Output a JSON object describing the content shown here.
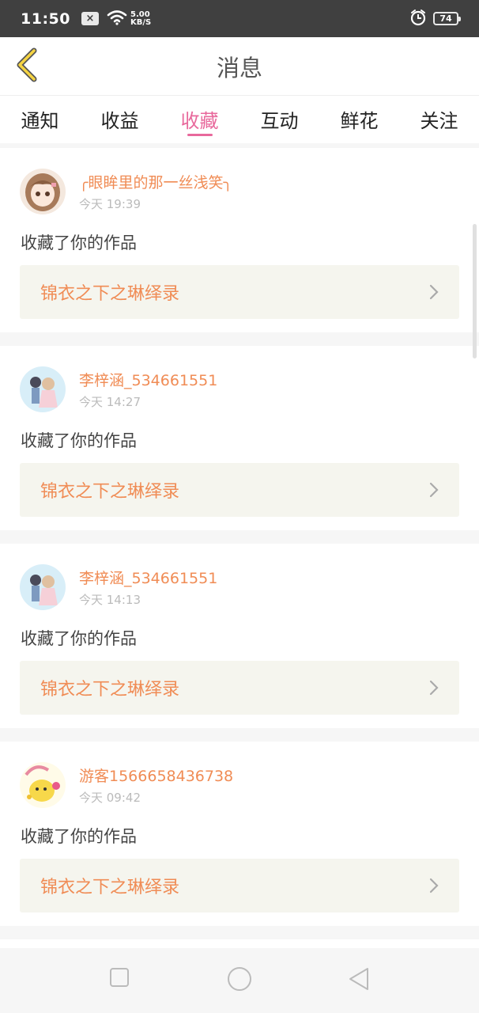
{
  "status_bar": {
    "time": "11:50",
    "notif_icon": "×",
    "speed_value": "5.00",
    "speed_unit": "KB/S",
    "battery": "74"
  },
  "header": {
    "title": "消息"
  },
  "tabs": [
    {
      "label": "通知",
      "active": false
    },
    {
      "label": "收益",
      "active": false
    },
    {
      "label": "收藏",
      "active": true
    },
    {
      "label": "互动",
      "active": false
    },
    {
      "label": "鲜花",
      "active": false
    },
    {
      "label": "关注",
      "active": false
    }
  ],
  "cards": [
    {
      "username": "╭眼眸里的那一丝浅笑╮",
      "time": "今天 19:39",
      "action": "收藏了你的作品",
      "work": "锦衣之下之琳绎录",
      "avatar": "avatar-girl-brown-hair"
    },
    {
      "username": "李梓涵_534661551",
      "time": "今天 14:27",
      "action": "收藏了你的作品",
      "work": "锦衣之下之琳绎录",
      "avatar": "avatar-couple"
    },
    {
      "username": "李梓涵_534661551",
      "time": "今天 14:13",
      "action": "收藏了你的作品",
      "work": "锦衣之下之琳绎录",
      "avatar": "avatar-couple"
    },
    {
      "username": "游客1566658436738",
      "time": "今天 09:42",
      "action": "收藏了你的作品",
      "work": "锦衣之下之琳绎录",
      "avatar": "avatar-cartoon-bear"
    }
  ],
  "colors": {
    "accent": "#e8699c",
    "orange": "#f08c55"
  }
}
